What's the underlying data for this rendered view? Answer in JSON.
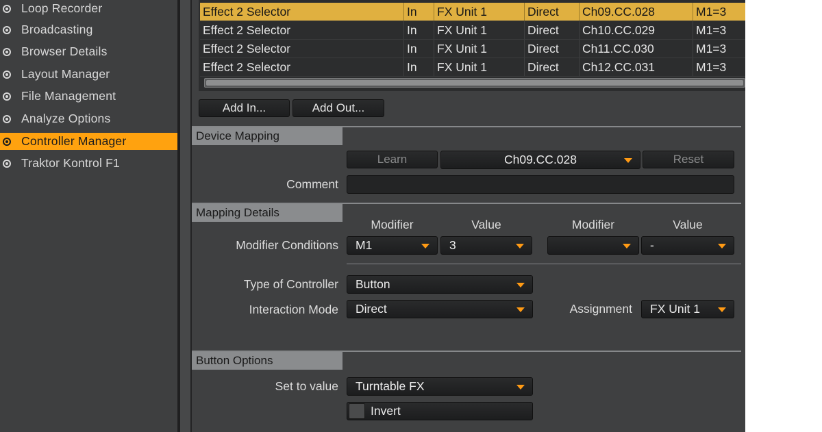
{
  "sidebar": {
    "items": [
      {
        "label": "Loop Recorder",
        "active": false
      },
      {
        "label": "Broadcasting",
        "active": false
      },
      {
        "label": "Browser Details",
        "active": false
      },
      {
        "label": "Layout Manager",
        "active": false
      },
      {
        "label": "File Management",
        "active": false
      },
      {
        "label": "Analyze Options",
        "active": false
      },
      {
        "label": "Controller Manager",
        "active": true
      },
      {
        "label": "Traktor Kontrol F1",
        "active": false
      }
    ]
  },
  "mapping_table": {
    "rows": [
      {
        "control": "Effect 2 Selector",
        "io": "In",
        "assignment": "FX Unit 1",
        "mode": "Direct",
        "mapped_to": "Ch09.CC.028",
        "modifier": "M1=3",
        "selected": true
      },
      {
        "control": "Effect 2 Selector",
        "io": "In",
        "assignment": "FX Unit 1",
        "mode": "Direct",
        "mapped_to": "Ch10.CC.029",
        "modifier": "M1=3",
        "selected": false
      },
      {
        "control": "Effect 2 Selector",
        "io": "In",
        "assignment": "FX Unit 1",
        "mode": "Direct",
        "mapped_to": "Ch11.CC.030",
        "modifier": "M1=3",
        "selected": false
      },
      {
        "control": "Effect 2 Selector",
        "io": "In",
        "assignment": "FX Unit 1",
        "mode": "Direct",
        "mapped_to": "Ch12.CC.031",
        "modifier": "M1=3",
        "selected": false
      }
    ]
  },
  "buttons": {
    "add_in": "Add In...",
    "add_out": "Add Out..."
  },
  "device_mapping": {
    "header": "Device Mapping",
    "learn": "Learn",
    "mapped_to": "Ch09.CC.028",
    "reset": "Reset",
    "comment_label": "Comment",
    "comment_value": ""
  },
  "mapping_details": {
    "header": "Mapping Details",
    "modifier_col": "Modifier",
    "value_col": "Value",
    "modifier_conditions_label": "Modifier Conditions",
    "modifier1": "M1",
    "value1": "3",
    "modifier2": "",
    "value2": "-",
    "type_of_controller_label": "Type of Controller",
    "type_of_controller": "Button",
    "interaction_mode_label": "Interaction Mode",
    "interaction_mode": "Direct",
    "assignment_label": "Assignment",
    "assignment": "FX Unit 1"
  },
  "button_options": {
    "header": "Button Options",
    "set_to_value_label": "Set to value",
    "set_to_value": "Turntable FX",
    "invert_label": "Invert",
    "invert_checked": false
  },
  "colors": {
    "accent": "#ffa20f",
    "selected_row": "#e0b040",
    "caret": "#ff9a14",
    "panel": "#3f4041"
  }
}
